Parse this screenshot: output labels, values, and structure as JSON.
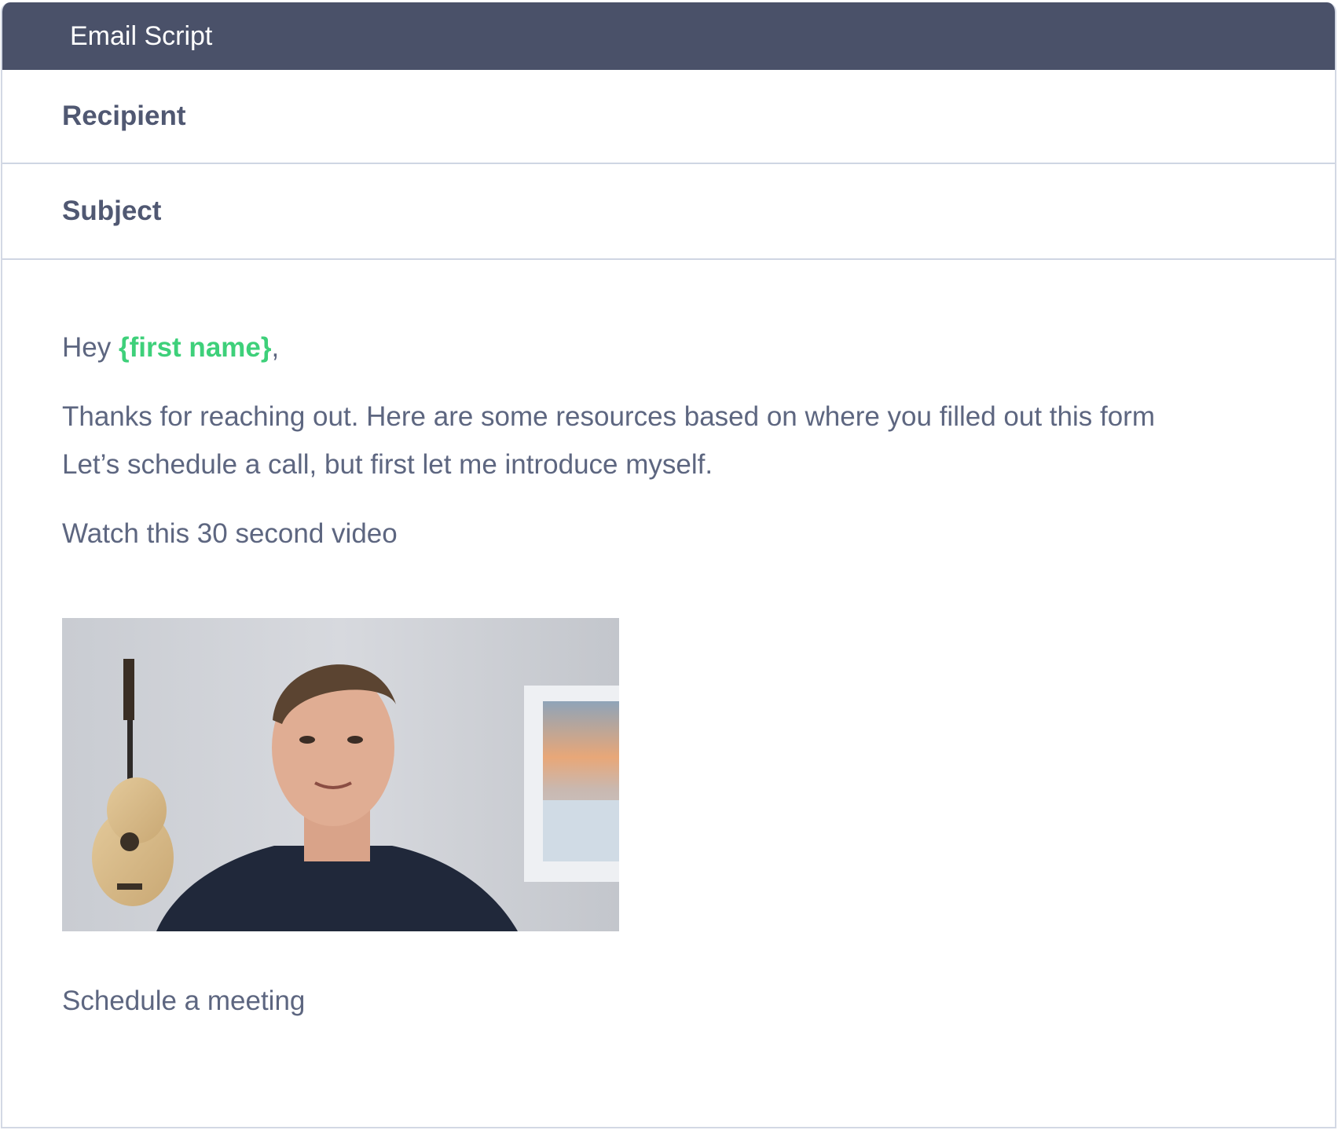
{
  "header": {
    "title": "Email Script"
  },
  "fields": {
    "recipient_label": "Recipient",
    "subject_label": "Subject"
  },
  "message": {
    "greeting_prefix": "Hey ",
    "greeting_placeholder": "{first name}",
    "greeting_suffix": ",",
    "line1": "Thanks for reaching out. Here are some resources based on where you filled out this form",
    "line2": "Let’s schedule a call, but first let me introduce myself.",
    "line3": "Watch this 30 second video",
    "line4": "Schedule a meeting"
  },
  "colors": {
    "header_bg": "#4a5169",
    "placeholder": "#3ed07a",
    "body_text": "#5d6680",
    "label_text": "#505872"
  },
  "video": {
    "icon": "video-thumbnail"
  }
}
